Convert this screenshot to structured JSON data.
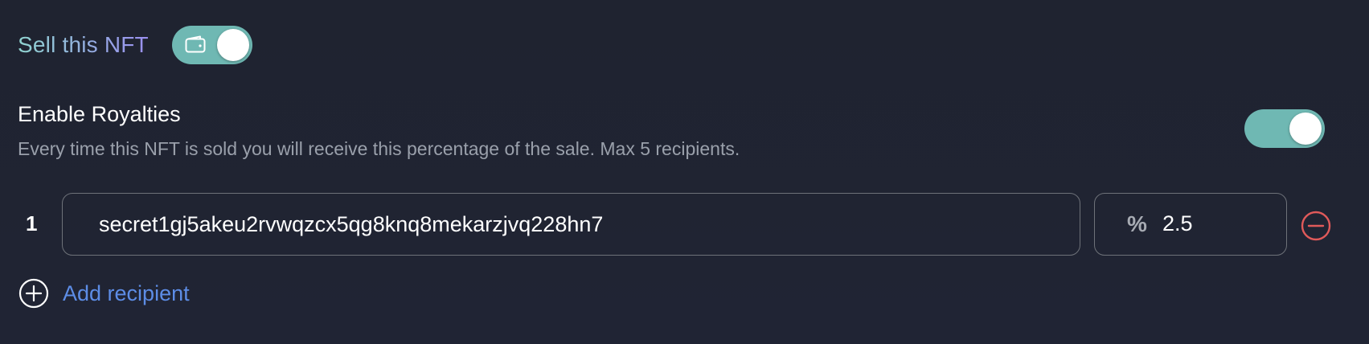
{
  "sell": {
    "label": "Sell this NFT",
    "enabled": true,
    "toggle_icon": "wallet-icon"
  },
  "royalties": {
    "title": "Enable Royalties",
    "description": "Every time this NFT is sold you will receive this percentage of the sale. Max 5 recipients.",
    "enabled": true
  },
  "recipients": [
    {
      "index": "1",
      "address": "secret1gj5akeu2rvwqzcx5qg8knq8mekarzjvq228hn7",
      "percent_symbol": "%",
      "percent": "2.5"
    }
  ],
  "add_recipient": {
    "label": "Add recipient"
  },
  "colors": {
    "toggle_on": "#6fb8b3",
    "remove": "#e05a5a",
    "link": "#5d8de6",
    "muted_text": "#9aa0ab"
  }
}
